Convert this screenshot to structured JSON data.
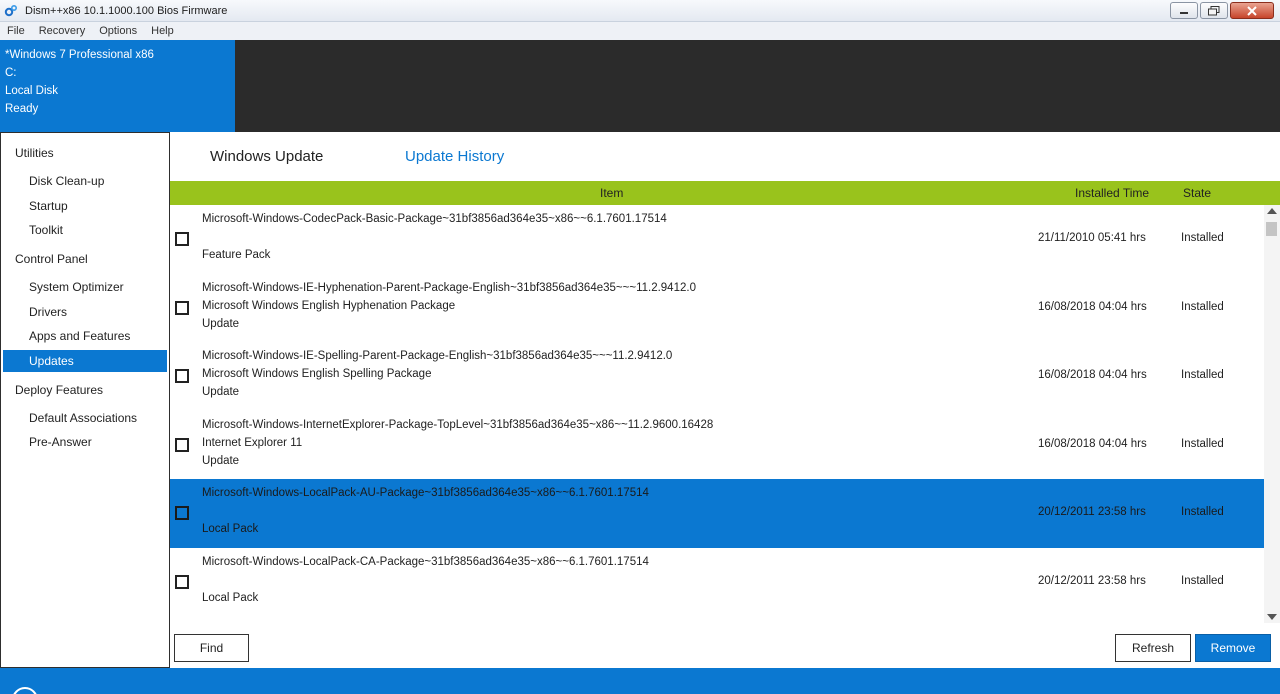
{
  "window": {
    "title": "Dism++x86 10.1.1000.100 Bios Firmware"
  },
  "menu": [
    "File",
    "Recovery",
    "Options",
    "Help"
  ],
  "info": {
    "os": "*Windows 7 Professional x86",
    "drive": "C:",
    "disk": "Local Disk",
    "status": "Ready"
  },
  "sidebar": {
    "groups": [
      {
        "label": "Utilities",
        "items": [
          "Disk Clean-up",
          "Startup",
          "Toolkit"
        ]
      },
      {
        "label": "Control Panel",
        "items": [
          "System Optimizer",
          "Drivers",
          "Apps and Features",
          "Updates"
        ]
      },
      {
        "label": "Deploy Features",
        "items": [
          "Default Associations",
          "Pre-Answer"
        ]
      }
    ],
    "active_item": "Updates"
  },
  "tabs": {
    "windows_update": "Windows Update",
    "update_history": "Update History"
  },
  "table": {
    "headers": {
      "item": "Item",
      "installed_time": "Installed Time",
      "state": "State"
    },
    "rows": [
      {
        "name": "Microsoft-Windows-CodecPack-Basic-Package~31bf3856ad364e35~x86~~6.1.7601.17514",
        "desc": "",
        "type": "Feature Pack",
        "time": "21/11/2010 05:41 hrs",
        "state": "Installed",
        "selected": false
      },
      {
        "name": "Microsoft-Windows-IE-Hyphenation-Parent-Package-English~31bf3856ad364e35~~~11.2.9412.0",
        "desc": "Microsoft Windows English Hyphenation Package",
        "type": "Update",
        "time": "16/08/2018 04:04 hrs",
        "state": "Installed",
        "selected": false
      },
      {
        "name": "Microsoft-Windows-IE-Spelling-Parent-Package-English~31bf3856ad364e35~~~11.2.9412.0",
        "desc": "Microsoft Windows English Spelling Package",
        "type": "Update",
        "time": "16/08/2018 04:04 hrs",
        "state": "Installed",
        "selected": false
      },
      {
        "name": "Microsoft-Windows-InternetExplorer-Package-TopLevel~31bf3856ad364e35~x86~~11.2.9600.16428",
        "desc": "Internet Explorer 11",
        "type": "Update",
        "time": "16/08/2018 04:04 hrs",
        "state": "Installed",
        "selected": false
      },
      {
        "name": "Microsoft-Windows-LocalPack-AU-Package~31bf3856ad364e35~x86~~6.1.7601.17514",
        "desc": "",
        "type": "Local Pack",
        "time": "20/12/2011 23:58 hrs",
        "state": "Installed",
        "selected": true
      },
      {
        "name": "Microsoft-Windows-LocalPack-CA-Package~31bf3856ad364e35~x86~~6.1.7601.17514",
        "desc": "",
        "type": "Local Pack",
        "time": "20/12/2011 23:58 hrs",
        "state": "Installed",
        "selected": false
      }
    ]
  },
  "buttons": {
    "find": "Find",
    "refresh": "Refresh",
    "remove": "Remove"
  },
  "colors": {
    "accent": "#0b78d1",
    "header_green": "#99c31c",
    "dark_panel": "#2b2b2b"
  }
}
